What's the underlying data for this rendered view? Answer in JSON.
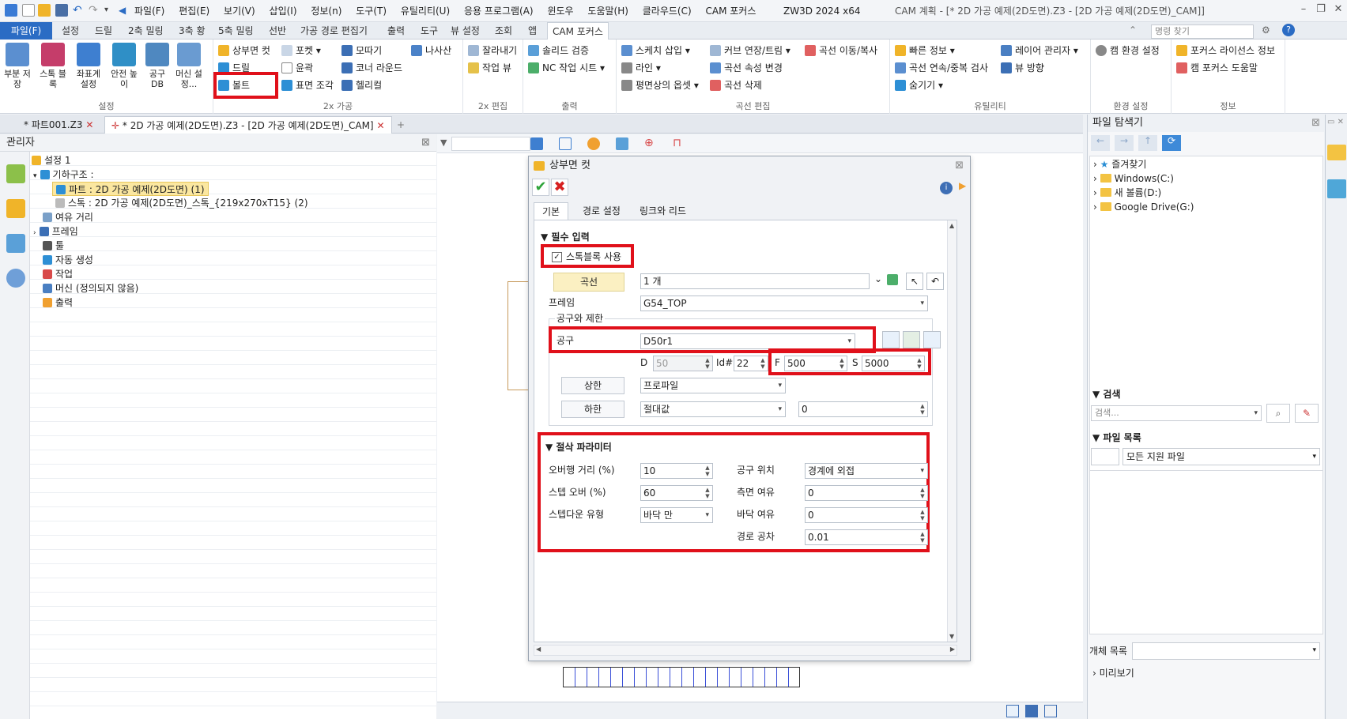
{
  "menu": [
    "파일(F)",
    "편집(E)",
    "보기(V)",
    "삽입(I)",
    "정보(n)",
    "도구(T)",
    "유틸리티(U)",
    "응용 프로그램(A)",
    "윈도우",
    "도움말(H)",
    "클라우드(C)",
    "CAM 포커스"
  ],
  "window": {
    "app": "ZW3D 2024 x64",
    "title": "CAM 계획 - [* 2D 가공 예제(2D도면).Z3 - [2D 가공 예제(2D도면)_CAM]]"
  },
  "ribbon_tabs": [
    "파일(F)",
    "설정",
    "드릴",
    "2축 밀링",
    "3축 황",
    "5축 밀링",
    "선반",
    "가공 경로 편집기",
    "출력",
    "도구",
    "뷰 설정",
    "조회",
    "앱",
    "CAM 포커스"
  ],
  "search_placeholder": "명령 찾기",
  "ribbon": {
    "setup": {
      "label": "설정",
      "buttons": [
        "부분 저장",
        "스톡 블록",
        "좌표계 설정",
        "안전 높이",
        "공구 DB",
        "머신 설정..."
      ]
    },
    "machining2x": {
      "label": "2x 가공",
      "buttons": [
        "상부면 컷",
        "포켓",
        "모따기",
        "나사산",
        "드릴",
        "윤곽",
        "코너 라운드",
        "볼트",
        "표면 조각",
        "헬리컬"
      ]
    },
    "edit2x": {
      "label": "2x 편집",
      "buttons": [
        "잘라내기",
        "작업 뷰"
      ]
    },
    "output": {
      "label": "출력",
      "buttons": [
        "솔리드 검증",
        "NC 작업 시트"
      ]
    },
    "curve_edit": {
      "label": "곡선 편집",
      "buttons": [
        "스케치 삽입",
        "커브 연장/트림",
        "곡선 이동/복사",
        "라인",
        "곡선 속성 변경",
        "평면상의 옵셋",
        "곡선 삭제"
      ]
    },
    "utility": {
      "label": "유틸리티",
      "buttons": [
        "빠른 정보",
        "레이어 관리자",
        "곡선 연속/중복 검사",
        "뷰 방향",
        "숨기기"
      ]
    },
    "env": {
      "label": "환경 설정",
      "buttons": [
        "캠 환경 설정"
      ]
    },
    "info": {
      "label": "정보",
      "buttons": [
        "포커스 라이선스 정보",
        "캠 포커스 도움말"
      ]
    }
  },
  "doc_tabs": [
    "* 파트001.Z3",
    "* 2D 가공 예제(2D도면).Z3 - [2D 가공 예제(2D도면)_CAM]"
  ],
  "manager": {
    "title": "관리자",
    "tree": [
      {
        "label": "설정 1",
        "indent": 0
      },
      {
        "label": "기하구조 :",
        "indent": 1
      },
      {
        "label": "파트 : 2D 가공 예제(2D도면) (1)",
        "indent": 2
      },
      {
        "label": "스톡 : 2D 가공 예제(2D도면)_스톡_{219x270xT15} (2)",
        "indent": 2
      },
      {
        "label": "여유 거리",
        "indent": 1
      },
      {
        "label": "프레임",
        "indent": 1
      },
      {
        "label": "툴",
        "indent": 1
      },
      {
        "label": "자동 생성",
        "indent": 1
      },
      {
        "label": "작업",
        "indent": 1
      },
      {
        "label": "머신 (정의되지 않음)",
        "indent": 1
      },
      {
        "label": "출력",
        "indent": 1
      }
    ]
  },
  "dialog": {
    "title": "상부면 컷",
    "tabs": [
      "기본",
      "경로 설정",
      "링크와 리드"
    ],
    "required_section": "필수 입력",
    "use_stock_label": "스톡블록 사용",
    "use_stock_checked": "✓",
    "curve_btn": "곡선",
    "curve_value": "1 개",
    "frame_label": "프레임",
    "frame_value": "G54_TOP",
    "tool_group": "공구와 제한",
    "tool_label": "공구",
    "tool_value": "D50r1",
    "D_label": "D",
    "D_value": "50",
    "id_label": "Id#",
    "id_value": "22",
    "F_label": "F",
    "F_value": "500",
    "S_label": "S",
    "S_value": "5000",
    "upper_btn": "상한",
    "upper_value": "프로파일",
    "lower_btn": "하한",
    "lower_value": "절대값",
    "lower_num": "0",
    "cut_section": "절삭 파라미터",
    "overhang_label": "오버행 거리 (%)",
    "overhang_value": "10",
    "stepover_label": "스텝 오버 (%)",
    "stepover_value": "60",
    "stepdown_label": "스텝다운 유형",
    "stepdown_value": "바닥 만",
    "toolpos_label": "공구 위치",
    "toolpos_value": "경계에 외접",
    "side_label": "측면 여유",
    "side_value": "0",
    "bottom_label": "바닥 여유",
    "bottom_value": "0",
    "tol_label": "경로 공차",
    "tol_value": "0.01"
  },
  "file_browser": {
    "title": "파일 탐색기",
    "items": [
      "즐겨찾기",
      "Windows(C:)",
      "새 볼륨(D:)",
      "Google Drive(G:)"
    ],
    "search_section": "검색",
    "search_placeholder": "검색...",
    "file_list_section": "파일 목록",
    "file_filter": "모든 지원 파일",
    "object_list": "개체 목록",
    "preview": "미리보기"
  },
  "colors": {
    "accent": "#2b6cc4",
    "highlight": "#e0101a",
    "selected": "#fbe7a0"
  }
}
